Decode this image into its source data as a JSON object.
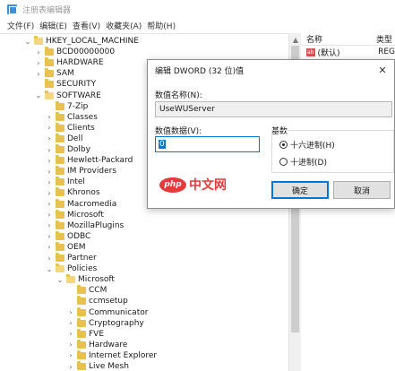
{
  "window": {
    "title": "注册表编辑器"
  },
  "menu": [
    "文件(F)",
    "编辑(E)",
    "查看(V)",
    "收藏夹(A)",
    "帮助(H)"
  ],
  "tree": [
    {
      "label": "HKEY_LOCAL_MACHINE",
      "level": 0,
      "expanded": true
    },
    {
      "label": "BCD00000000",
      "level": 1,
      "expanded": false
    },
    {
      "label": "HARDWARE",
      "level": 1,
      "expanded": false
    },
    {
      "label": "SAM",
      "level": 1,
      "expanded": false
    },
    {
      "label": "SECURITY",
      "level": 1,
      "expanded": null
    },
    {
      "label": "SOFTWARE",
      "level": 1,
      "expanded": true
    },
    {
      "label": "7-Zip",
      "level": 2,
      "expanded": null
    },
    {
      "label": "Classes",
      "level": 2,
      "expanded": false
    },
    {
      "label": "Clients",
      "level": 2,
      "expanded": false
    },
    {
      "label": "Dell",
      "level": 2,
      "expanded": false
    },
    {
      "label": "Dolby",
      "level": 2,
      "expanded": false
    },
    {
      "label": "Hewlett-Packard",
      "level": 2,
      "expanded": false
    },
    {
      "label": "IM Providers",
      "level": 2,
      "expanded": false
    },
    {
      "label": "Intel",
      "level": 2,
      "expanded": false
    },
    {
      "label": "Khronos",
      "level": 2,
      "expanded": false
    },
    {
      "label": "Macromedia",
      "level": 2,
      "expanded": false
    },
    {
      "label": "Microsoft",
      "level": 2,
      "expanded": false
    },
    {
      "label": "MozillaPlugins",
      "level": 2,
      "expanded": false
    },
    {
      "label": "ODBC",
      "level": 2,
      "expanded": false
    },
    {
      "label": "OEM",
      "level": 2,
      "expanded": false
    },
    {
      "label": "Partner",
      "level": 2,
      "expanded": false
    },
    {
      "label": "Policies",
      "level": 2,
      "expanded": true
    },
    {
      "label": "Microsoft",
      "level": 3,
      "expanded": true
    },
    {
      "label": "CCM",
      "level": 4,
      "expanded": null
    },
    {
      "label": "ccmsetup",
      "level": 4,
      "expanded": null
    },
    {
      "label": "Communicator",
      "level": 4,
      "expanded": false
    },
    {
      "label": "Cryptography",
      "level": 4,
      "expanded": false
    },
    {
      "label": "FVE",
      "level": 4,
      "expanded": false
    },
    {
      "label": "Hardware",
      "level": 4,
      "expanded": false
    },
    {
      "label": "Internet Explorer",
      "level": 4,
      "expanded": false
    },
    {
      "label": "Live Mesh",
      "level": 4,
      "expanded": false
    }
  ],
  "values": {
    "col_name": "名称",
    "col_type": "类型",
    "rows": [
      {
        "name": "(默认)",
        "type": "REG"
      }
    ]
  },
  "dialog": {
    "title": "编辑 DWORD (32 位)值",
    "name_label": "数值名称(N):",
    "name_value": "UseWUServer",
    "data_label": "数值数据(V):",
    "data_value": "0",
    "base_label": "基数",
    "hex_label": "十六进制(H)",
    "dec_label": "十进制(D)",
    "selected_base": "hex",
    "ok_label": "确定",
    "cancel_label": "取消"
  },
  "watermark": {
    "logo": "php",
    "text": "中文网"
  },
  "colors": {
    "accent": "#0078d7",
    "folder": "#e8c14e",
    "watermark": "#e83a3a"
  }
}
